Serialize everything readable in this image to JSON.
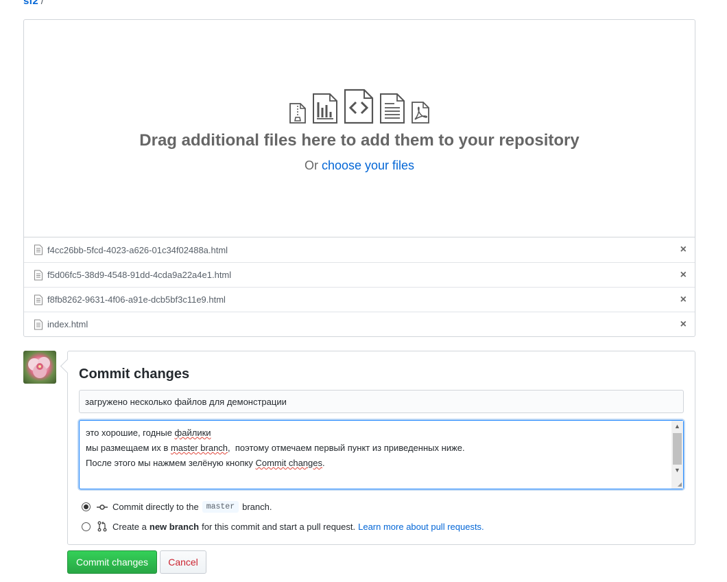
{
  "breadcrumb": {
    "repo": "sf2",
    "separator": "/"
  },
  "dropzone": {
    "icons": [
      "file-zip-icon",
      "graph-icon",
      "file-code-icon",
      "file-text-icon",
      "file-pdf-icon"
    ],
    "title": "Drag additional files here to add them to your repository",
    "subtitle_prefix": "Or",
    "choose_link": "choose your files"
  },
  "files": [
    {
      "name": "f4cc26bb-5fcd-4023-a626-01c34f02488a.html"
    },
    {
      "name": "f5d06fc5-38d9-4548-91dd-4cda9a22a4e1.html"
    },
    {
      "name": "f8fb8262-9631-4f06-a91e-dcb5bf3c11e9.html"
    },
    {
      "name": "index.html"
    }
  ],
  "remove_glyph": "×",
  "commit": {
    "title": "Commit changes",
    "summary_value": "загружено несколько файлов для демонстрации",
    "description_lines": [
      [
        "это хорошие, годные ",
        "файлики",
        ""
      ],
      [
        "мы размещаем их в ",
        "master branch",
        ",  поэтому отмечаем первый пункт из приведенных ниже."
      ],
      [
        "После этого мы нажмем зелёную кнопку ",
        "Commit changes",
        "."
      ]
    ],
    "option_direct": {
      "prefix": "Commit directly to the",
      "branch": "master",
      "suffix": "branch."
    },
    "option_new": {
      "prefix": "Create a",
      "bold": "new branch",
      "suffix": "for this commit and start a pull request.",
      "link": "Learn more about pull requests."
    }
  },
  "buttons": {
    "commit": "Commit changes",
    "cancel": "Cancel"
  },
  "colors": {
    "link": "#0366d6",
    "commit_button": "#28a745",
    "cancel_text": "#cb2431",
    "focus_border": "#2188ff"
  }
}
